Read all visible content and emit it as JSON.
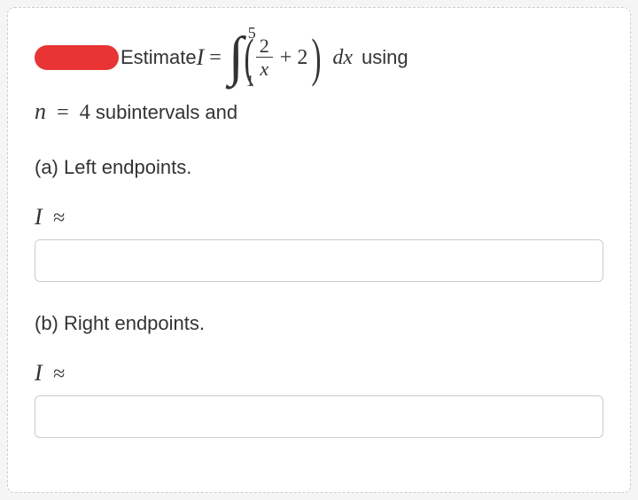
{
  "problem": {
    "estimate_prefix": "Estimate ",
    "I_symbol": "I",
    "equals": "=",
    "integral_lower": "1",
    "integral_upper": "5",
    "frac_num": "2",
    "frac_den": "x",
    "plus_term": "+ 2",
    "dx": "dx",
    "using_suffix": " using",
    "n_symbol": "n",
    "n_value": "4",
    "sub_text": " subintervals and"
  },
  "partA": {
    "label": "(a) Left endpoints.",
    "I_approx": "I",
    "approx_sym": "≈",
    "value": ""
  },
  "partB": {
    "label": "(b) Right endpoints.",
    "I_approx": "I",
    "approx_sym": "≈",
    "value": ""
  }
}
